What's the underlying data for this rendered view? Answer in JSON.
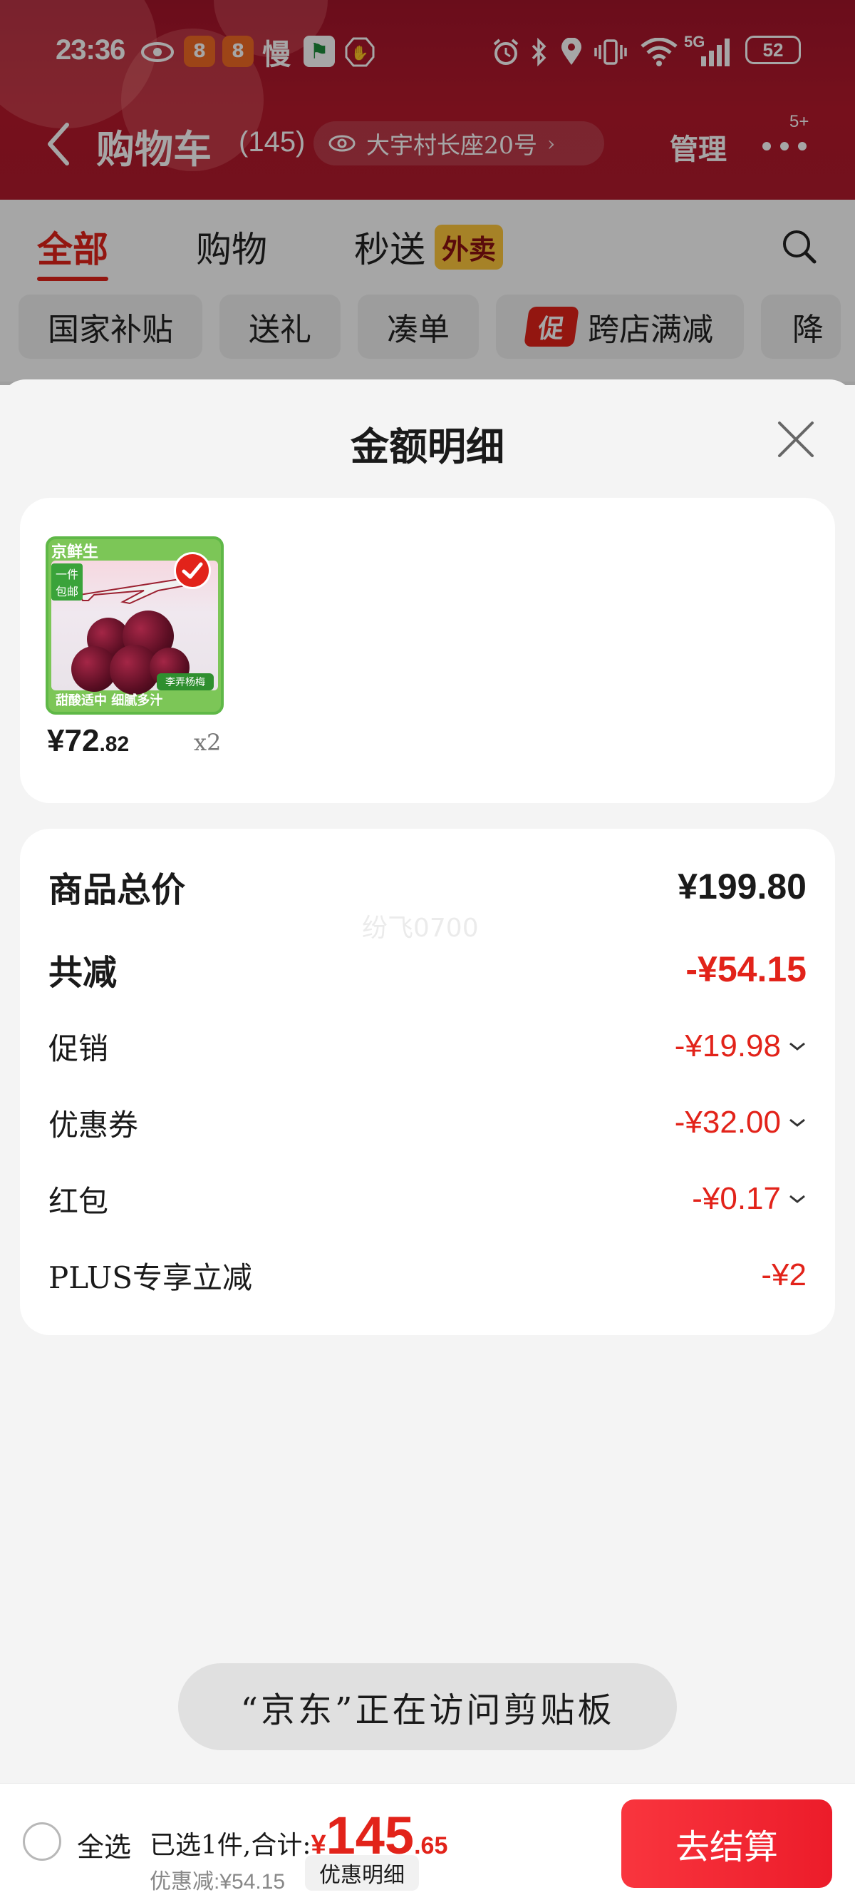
{
  "status_bar": {
    "time": "23:36",
    "slow_label": "慢",
    "network": "5G",
    "battery": "52"
  },
  "nav": {
    "title": "购物车",
    "count": "(145)",
    "address": "大宇村长座20号",
    "manage": "管理",
    "message_badge": "5+"
  },
  "tabs": {
    "all": "全部",
    "shopping": "购物",
    "flash": "秒送",
    "takeout_badge": "外卖"
  },
  "filters": {
    "subsidy": "国家补贴",
    "gift": "送礼",
    "bundle": "凑单",
    "promo_badge": "促",
    "cross_store": "跨店满减",
    "price_drop": "降"
  },
  "sheet": {
    "title": "金额明细",
    "watermark": "纷飞0700"
  },
  "goods": {
    "brand": "京鲜生",
    "badge": "一件包邮",
    "product_label": "李弄杨梅",
    "bottom_caption": "甜酸适中 细腻多汁",
    "price_currency": "¥",
    "price_int": "72",
    "price_dec": ".82",
    "qty": "x2"
  },
  "detail": {
    "total_label": "商品总价",
    "total_value": "¥199.80",
    "reduce_label": "共减",
    "reduce_value": "-¥54.15",
    "promo_label": "促销",
    "promo_value": "-¥19.98",
    "coupon_label": "优惠券",
    "coupon_value": "-¥32.00",
    "redpacket_label": "红包",
    "redpacket_value": "-¥0.17",
    "plus_label": "PLUS专享立减",
    "plus_value": "-¥2"
  },
  "toast": "“京东”正在访问剪贴板",
  "bottom_bar": {
    "select_all": "全选",
    "summary_prefix": "已选1件,合计:",
    "sum_currency": "¥",
    "sum_int": "145",
    "sum_dec": ".65",
    "discount": "优惠减:¥54.15",
    "detail_button": "优惠明细",
    "checkout": "去结算"
  },
  "colors": {
    "brand_red": "#e2231a",
    "header_red": "#b21b2d",
    "takeout_yellow": "#ffc83d"
  }
}
